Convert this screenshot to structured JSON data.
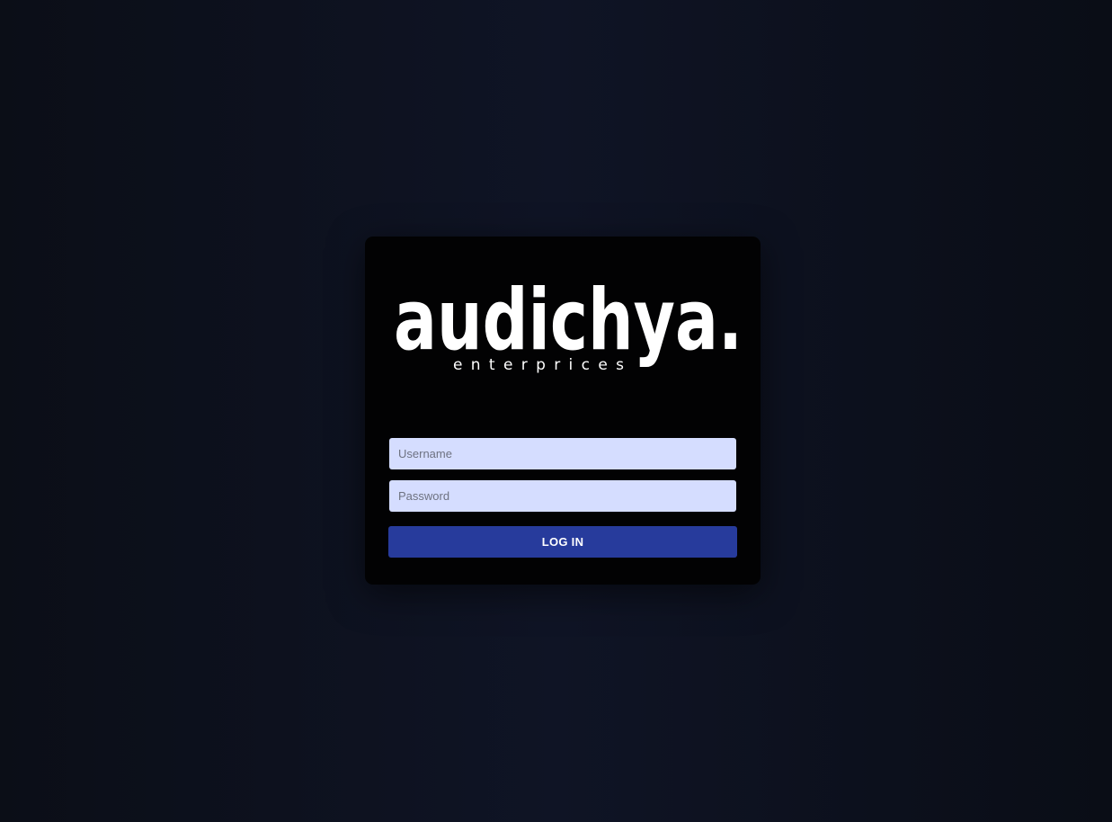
{
  "brand": {
    "name": "audichya.",
    "tagline": "enterprices"
  },
  "form": {
    "username_placeholder": "Username",
    "username_value": "",
    "password_placeholder": "Password",
    "password_value": "",
    "login_label": "LOG IN"
  },
  "colors": {
    "page_background": "#0d1120",
    "card_background": "#020203",
    "input_background": "#d5ddff",
    "button_background": "#273b9c",
    "button_text": "#ffffff",
    "logo": "#ffffff"
  }
}
